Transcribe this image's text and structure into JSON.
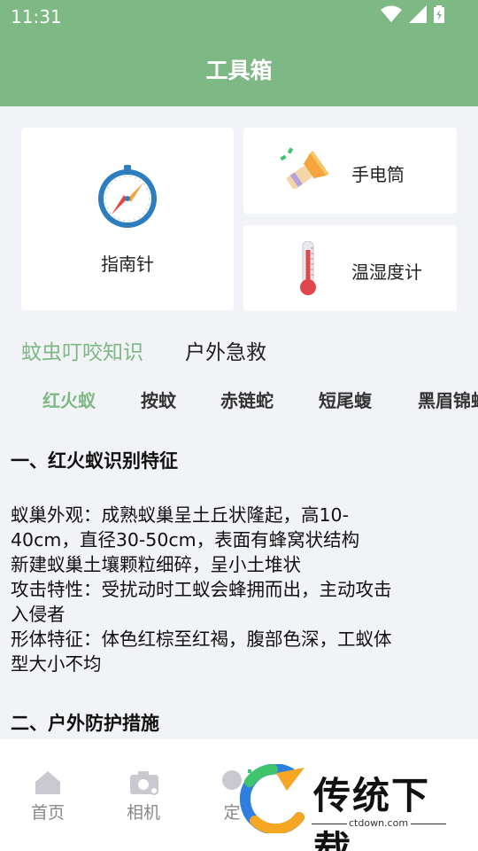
{
  "status_bar": {
    "time": "11:31"
  },
  "header": {
    "title": "工具箱"
  },
  "tools": [
    {
      "label": "指南针",
      "icon": "compass-icon"
    },
    {
      "label": "手电筒",
      "icon": "flashlight-icon"
    },
    {
      "label": "温湿度计",
      "icon": "thermometer-icon"
    }
  ],
  "main_tabs": [
    {
      "label": "蚊虫叮咬知识",
      "active": true
    },
    {
      "label": "户外急救",
      "active": false
    }
  ],
  "sub_tabs": [
    {
      "label": "红火蚁",
      "active": true
    },
    {
      "label": "按蚊",
      "active": false
    },
    {
      "label": "赤链蛇",
      "active": false
    },
    {
      "label": "短尾蝮",
      "active": false
    },
    {
      "label": "黑眉锦蛇",
      "active": false
    }
  ],
  "article": {
    "section1_title": "一、红火蚁识别特征",
    "lines": [
      "蚁巢外观：成熟蚁巢呈土丘状隆起，高10-",
      "40cm，直径30-50cm，表面有蜂窝状结构",
      "新建蚁巢土壤颗粒细碎，呈小土堆状",
      "攻击特性：受扰动时工蚁会蜂拥而出，主动攻击",
      "入侵者",
      "形体特征：体色红棕至红褐，腹部色深，工蚁体",
      "型大小不均"
    ],
    "section2_title": "二、户外防护措施"
  },
  "bottom_nav": [
    {
      "label": "首页",
      "icon": "home-icon"
    },
    {
      "label": "相机",
      "icon": "camera-icon"
    },
    {
      "label": "定",
      "icon": "location-icon"
    }
  ],
  "watermark": {
    "text": "传统下载",
    "url": "ctdown.com"
  },
  "colors": {
    "accent": "#7db885",
    "background": "#f2f3f6",
    "card": "#ffffff"
  }
}
